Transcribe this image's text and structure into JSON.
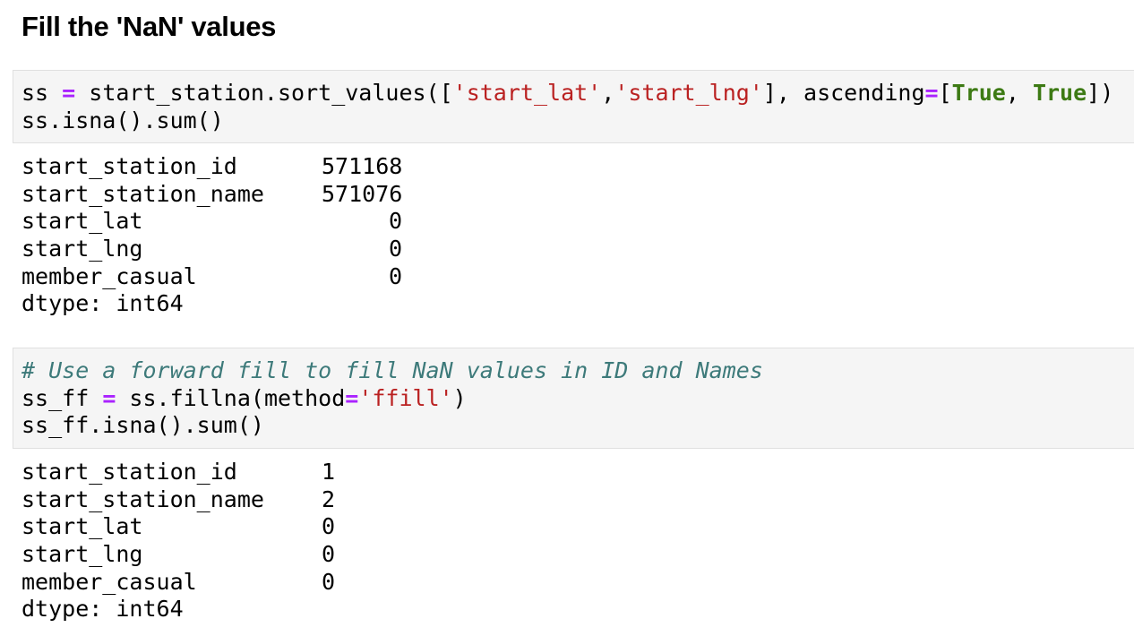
{
  "heading": "Fill the 'NaN' values",
  "cell1": {
    "lines": [
      {
        "tokens": [
          {
            "t": "ss ",
            "c": "plain"
          },
          {
            "t": "=",
            "c": "op"
          },
          {
            "t": " start_station.sort_values([",
            "c": "plain"
          },
          {
            "t": "'start_lat'",
            "c": "str"
          },
          {
            "t": ",",
            "c": "plain"
          },
          {
            "t": "'start_lng'",
            "c": "str"
          },
          {
            "t": "], ascending",
            "c": "plain"
          },
          {
            "t": "=",
            "c": "op"
          },
          {
            "t": "[",
            "c": "plain"
          },
          {
            "t": "True",
            "c": "kwc"
          },
          {
            "t": ", ",
            "c": "plain"
          },
          {
            "t": "True",
            "c": "kwc"
          },
          {
            "t": "])",
            "c": "plain"
          }
        ]
      },
      {
        "tokens": [
          {
            "t": "ss.isna().sum()",
            "c": "plain"
          }
        ]
      }
    ]
  },
  "output1": {
    "rows": [
      {
        "key": "start_station_id",
        "value": "571168"
      },
      {
        "key": "start_station_name",
        "value": "571076"
      },
      {
        "key": "start_lat",
        "value": "0"
      },
      {
        "key": "start_lng",
        "value": "0"
      },
      {
        "key": "member_casual",
        "value": "0"
      }
    ],
    "dtype": "dtype: int64"
  },
  "cell2": {
    "lines": [
      {
        "tokens": [
          {
            "t": "# Use a forward fill to fill NaN values in ID and Names",
            "c": "cmc"
          }
        ]
      },
      {
        "tokens": [
          {
            "t": "ss_ff ",
            "c": "plain"
          },
          {
            "t": "=",
            "c": "op"
          },
          {
            "t": " ss.fillna(method",
            "c": "plain"
          },
          {
            "t": "=",
            "c": "op"
          },
          {
            "t": "'ffill'",
            "c": "str"
          },
          {
            "t": ")",
            "c": "plain"
          }
        ]
      },
      {
        "tokens": [
          {
            "t": "ss_ff.isna().sum()",
            "c": "plain"
          }
        ]
      }
    ]
  },
  "output2": {
    "rows": [
      {
        "key": "start_station_id",
        "value": "1"
      },
      {
        "key": "start_station_name",
        "value": "2"
      },
      {
        "key": "start_lat",
        "value": "0"
      },
      {
        "key": "start_lng",
        "value": "0"
      },
      {
        "key": "member_casual",
        "value": "0"
      }
    ],
    "dtype": "dtype: int64"
  },
  "colors": {
    "operator": "#aa22ff",
    "string": "#ba2121",
    "keyword": "#3d7a14",
    "comment": "#3d7a7a",
    "cell_background": "#f5f5f5",
    "cell_border": "#e0e0e0"
  }
}
